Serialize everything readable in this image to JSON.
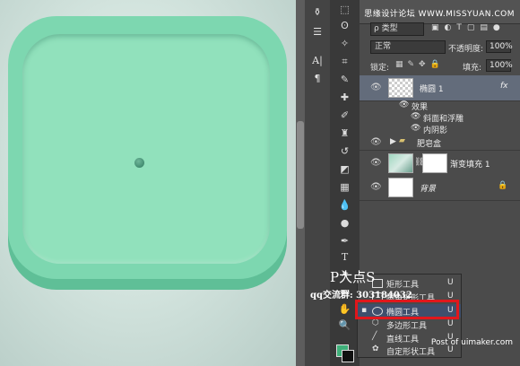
{
  "watermark_top": "思缘设计论坛 WWW.MISSYUAN.COM",
  "watermark_overlay": {
    "big": "P大点S",
    "qq": "qq交流群: 303184032"
  },
  "watermark_bottom": "Post of uimaker.com",
  "layers_panel": {
    "filter_label": "ρ 类型",
    "blend_mode": "正常",
    "opacity_label": "不透明度:",
    "opacity_value": "100%",
    "lock_label": "锁定:",
    "fill_label": "填充:",
    "fill_value": "100%",
    "layers": [
      {
        "name": "椭圆 1",
        "selected": true,
        "fx": "fx"
      },
      {
        "effects_label": "效果"
      },
      {
        "effect": "斜面和浮雕"
      },
      {
        "effect": "内阴影"
      },
      {
        "name": "肥皂盒",
        "type": "group"
      },
      {
        "name": "渐变填充 1"
      },
      {
        "name": "背景",
        "locked": true
      }
    ]
  },
  "flyout": {
    "items": [
      {
        "label": "矩形工具",
        "key": "U",
        "icon": "rectangle-icon"
      },
      {
        "label": "圆角矩形工具",
        "key": "U",
        "icon": "rounded-rect-icon"
      },
      {
        "label": "椭圆工具",
        "key": "U",
        "icon": "ellipse-icon",
        "active": true
      },
      {
        "label": "多边形工具",
        "key": "U",
        "icon": "polygon-icon"
      },
      {
        "label": "直线工具",
        "key": "U",
        "icon": "line-icon"
      },
      {
        "label": "自定形状工具",
        "key": "U",
        "icon": "custom-shape-icon"
      }
    ]
  },
  "colors": {
    "foreground": "#3fb07a",
    "background": "#111111",
    "highlight": "#e0171c"
  }
}
